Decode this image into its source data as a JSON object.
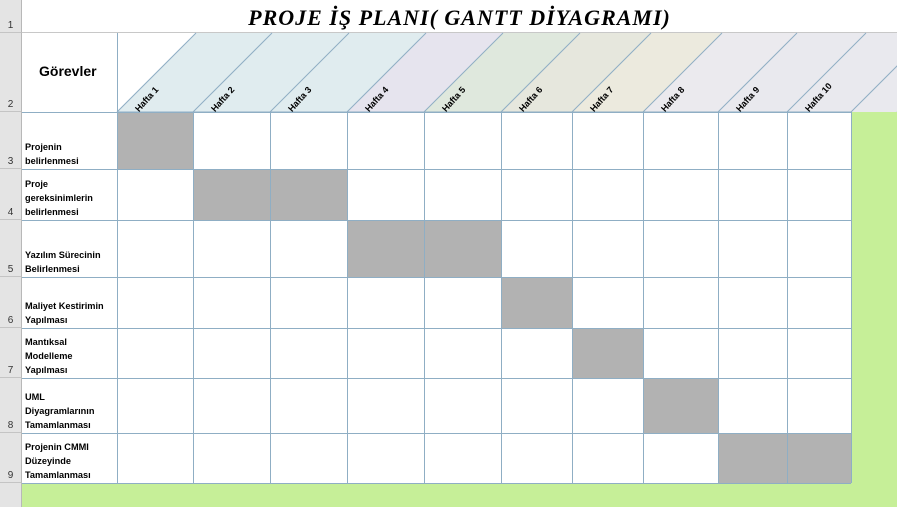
{
  "title": "PROJE İŞ PLANI( GANTT DİYAGRAMI)",
  "row_numbers": [
    "1",
    "2",
    "3",
    "4",
    "5",
    "6",
    "7",
    "8",
    "9"
  ],
  "tasks_header": "Görevler",
  "weeks": [
    "Hafta 1",
    "Hafta 2",
    "Hafta 3",
    "Hafta 4",
    "Hafta 5",
    "Hafta 6",
    "Hafta 7",
    "Hafta 8",
    "Hafta 9",
    "Hafta 10"
  ],
  "tasks": [
    {
      "label": "Projenin\nbelirlenmesi",
      "weeks_active": [
        1
      ]
    },
    {
      "label": "Proje\ngereksinimlerin\nbelirlenmesi",
      "weeks_active": [
        2,
        3
      ]
    },
    {
      "label": "Yazılım Sürecinin\nBelirlenmesi",
      "weeks_active": [
        4,
        5
      ]
    },
    {
      "label": "Maliyet Kestirimin\nYapılması",
      "weeks_active": [
        6
      ]
    },
    {
      "label": "Mantıksal\nModelleme\nYapılması",
      "weeks_active": [
        7
      ]
    },
    {
      "label": "UML\nDiyagramlarının\nTamamlanması",
      "weeks_active": [
        8
      ]
    },
    {
      "label": "Projenin CMMI\nDüzeyinde\nTamamlanması",
      "weeks_active": [
        9,
        10
      ]
    }
  ],
  "colors": {
    "filled_cell": "#b2b2b2",
    "grid_line": "#8faec4",
    "background_green": "#c6ef98",
    "header_bands": [
      "#e0ecef",
      "#e0ecef",
      "#e0ecef",
      "#e6e4ee",
      "#dfe8dd",
      "#e6e7dd",
      "#eceade",
      "#ebeaee",
      "#e9e9ee",
      "#e9e9ee",
      "#e9e9ee"
    ]
  }
}
